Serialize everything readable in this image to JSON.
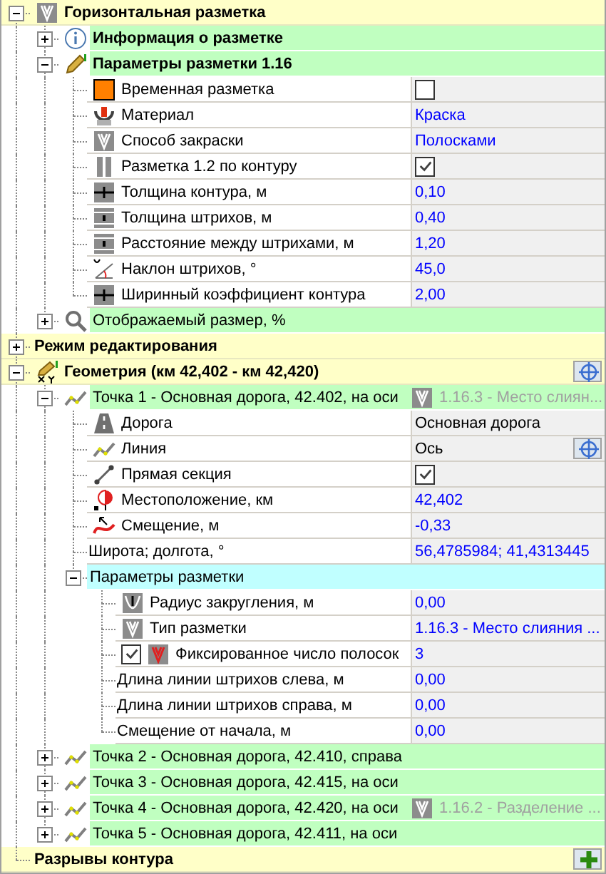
{
  "tree": [
    {
      "kind": "category",
      "label": "Горизонтальная разметка",
      "expanded": true,
      "children": [
        {
          "kind": "group",
          "label": "Информация о разметке",
          "bold": true,
          "expanded": false
        },
        {
          "kind": "group",
          "label": "Параметры разметки 1.16",
          "bold": true,
          "expanded": true,
          "children": [
            {
              "kind": "property",
              "label": "Временная разметка",
              "checked": false
            },
            {
              "kind": "property",
              "label": "Материал",
              "value": "Краска",
              "editable": true
            },
            {
              "kind": "property",
              "label": "Способ закраски",
              "value": "Полосками",
              "editable": true
            },
            {
              "kind": "property",
              "label": "Разметка 1.2 по контуру",
              "checked": true
            },
            {
              "kind": "property",
              "label": "Толщина контура, м",
              "value": "0,10",
              "editable": true
            },
            {
              "kind": "property",
              "label": "Толщина штрихов, м",
              "value": "0,40",
              "editable": true
            },
            {
              "kind": "property",
              "label": "Расстояние между штрихами, м",
              "value": "1,20",
              "editable": true
            },
            {
              "kind": "property",
              "label": "Наклон штрихов, °",
              "value": "45,0",
              "editable": true
            },
            {
              "kind": "property",
              "label": "Ширинный коэффициент контура",
              "value": "2,00",
              "editable": true
            }
          ]
        },
        {
          "kind": "group",
          "label": "Отображаемый размер, %",
          "bold": false,
          "expanded": false
        }
      ]
    },
    {
      "kind": "category",
      "label": "Режим редактирования",
      "expanded": false
    },
    {
      "kind": "category",
      "label": "Геометрия (км 42,402 - км 42,420)",
      "expanded": true,
      "locate_button": true,
      "children": [
        {
          "kind": "group",
          "label": "Точка 1 - Основная дорога, 42.402, на оси",
          "bold": false,
          "expanded": true,
          "note": "1.16.3 - Место слиян...",
          "children": [
            {
              "kind": "property",
              "label": "Дорога",
              "value": "Основная дорога",
              "editable": false
            },
            {
              "kind": "property",
              "label": "Линия",
              "value": "Ось",
              "editable": false,
              "locate_button": true
            },
            {
              "kind": "property",
              "label": "Прямая секция",
              "checked": true
            },
            {
              "kind": "property",
              "label": "Местоположение, км",
              "value": "42,402",
              "editable": true
            },
            {
              "kind": "property",
              "label": "Смещение, м",
              "value": "-0,33",
              "editable": true
            },
            {
              "kind": "property",
              "label": "Широта; долгота, °",
              "value": "56,4785984; 41,4313445",
              "editable": true
            },
            {
              "kind": "subgroup",
              "label": "Параметры разметки",
              "expanded": true,
              "children": [
                {
                  "kind": "property",
                  "label": "Радиус закругления, м",
                  "value": "0,00",
                  "editable": true
                },
                {
                  "kind": "property",
                  "label": "Тип разметки",
                  "value": "1.16.3 - Место слияния ...",
                  "editable": true
                },
                {
                  "kind": "property",
                  "label": "Фиксированное число полосок",
                  "name_checked": true,
                  "value": "3",
                  "editable": true
                },
                {
                  "kind": "property",
                  "label": "Длина линии штрихов слева, м",
                  "value": "0,00",
                  "editable": true
                },
                {
                  "kind": "property",
                  "label": "Длина линии штрихов справа, м",
                  "value": "0,00",
                  "editable": true
                },
                {
                  "kind": "property",
                  "label": "Смещение от начала, м",
                  "value": "0,00",
                  "editable": true
                }
              ]
            }
          ]
        },
        {
          "kind": "group",
          "label": "Точка 2 - Основная дорога, 42.410, справа",
          "bold": false,
          "expanded": false
        },
        {
          "kind": "group",
          "label": "Точка 3 - Основная дорога, 42.415, на оси",
          "bold": false,
          "expanded": false
        },
        {
          "kind": "group",
          "label": "Точка 4 - Основная дорога, 42.420, на оси",
          "bold": false,
          "expanded": false,
          "note": "1.16.2 - Разделение ..."
        },
        {
          "kind": "group",
          "label": "Точка 5 - Основная дорога, 42.411, на оси",
          "bold": false,
          "expanded": false
        }
      ]
    },
    {
      "kind": "category",
      "label": "Разрывы контура",
      "add_button": true
    }
  ]
}
